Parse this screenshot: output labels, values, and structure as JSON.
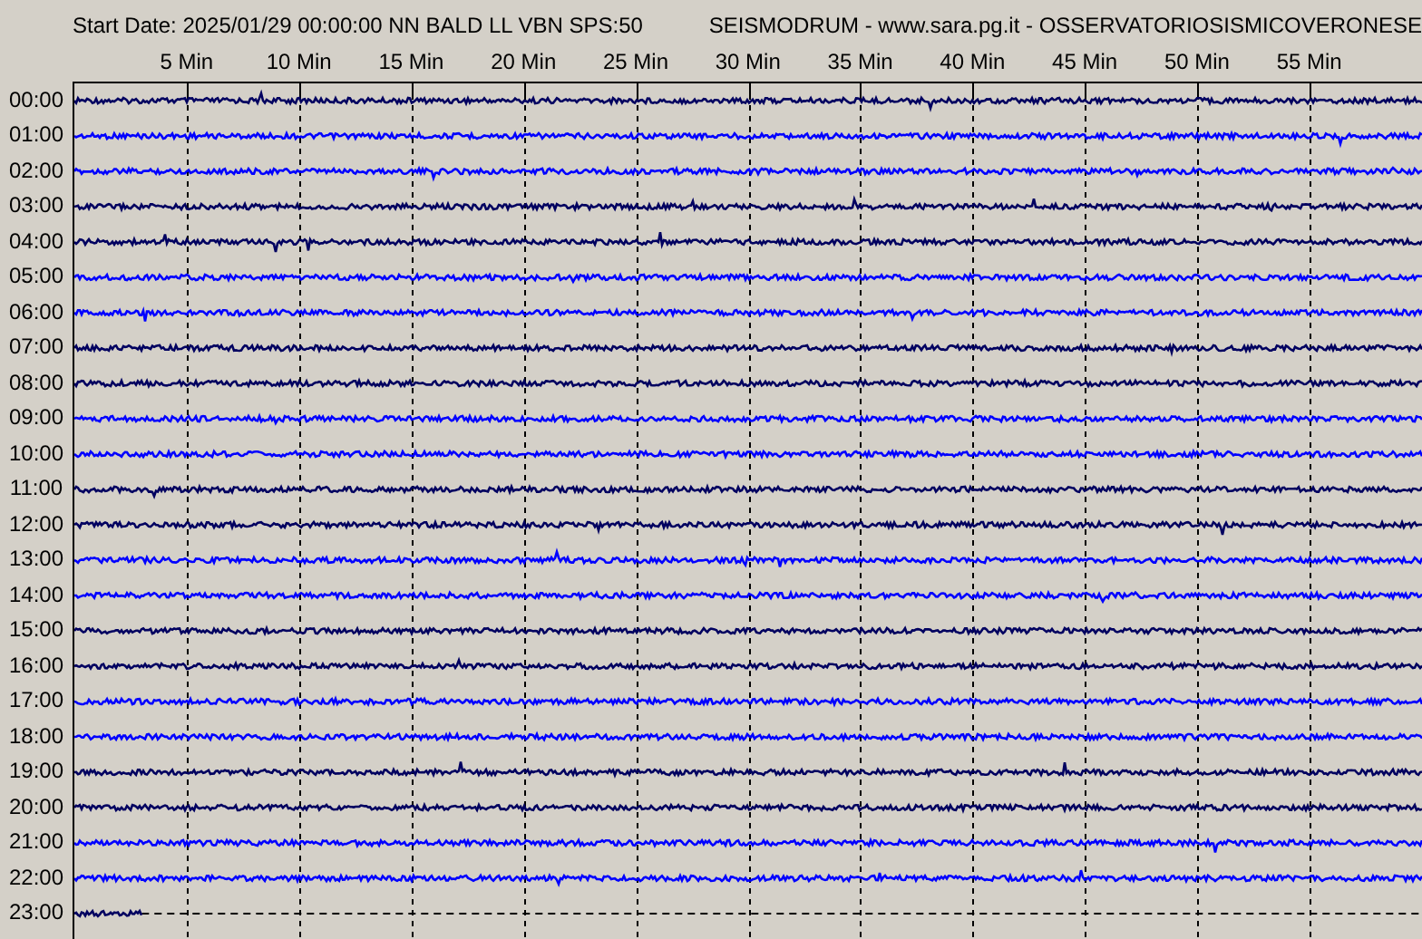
{
  "header": {
    "start_date": "Start Date: 2025/01/29 00:00:00 NN BALD LL VBN SPS:50",
    "title": "SEISMODRUM - www.sara.pg.it - OSSERVATORIOSISMICOVERONESE"
  },
  "minute_labels": [
    "5 Min",
    "10 Min",
    "15 Min",
    "20 Min",
    "25 Min",
    "30 Min",
    "35 Min",
    "40 Min",
    "45 Min",
    "50 Min",
    "55 Min"
  ],
  "rows": [
    {
      "time": "00:00",
      "color": "#000060",
      "level": 1
    },
    {
      "time": "01:00",
      "color": "#0000ff",
      "level": 1
    },
    {
      "time": "02:00",
      "color": "#0000ff",
      "level": 1
    },
    {
      "time": "03:00",
      "color": "#000060",
      "level": 1
    },
    {
      "time": "04:00",
      "color": "#000060",
      "level": 1
    },
    {
      "time": "05:00",
      "color": "#0000ff",
      "level": 1
    },
    {
      "time": "06:00",
      "color": "#0000ff",
      "level": 1
    },
    {
      "time": "07:00",
      "color": "#000060",
      "level": 1
    },
    {
      "time": "08:00",
      "color": "#000060",
      "level": 1
    },
    {
      "time": "09:00",
      "color": "#0000ff",
      "level": 1
    },
    {
      "time": "10:00",
      "color": "#0000ff",
      "level": 1
    },
    {
      "time": "11:00",
      "color": "#000060",
      "level": 1
    },
    {
      "time": "12:00",
      "color": "#000060",
      "level": 1
    },
    {
      "time": "13:00",
      "color": "#0000ff",
      "level": 1
    },
    {
      "time": "14:00",
      "color": "#0000ff",
      "level": 1
    },
    {
      "time": "15:00",
      "color": "#000060",
      "level": 1
    },
    {
      "time": "16:00",
      "color": "#000060",
      "level": 1
    },
    {
      "time": "17:00",
      "color": "#0000ff",
      "level": 1
    },
    {
      "time": "18:00",
      "color": "#0000ff",
      "level": 1
    },
    {
      "time": "19:00",
      "color": "#000060",
      "level": 1
    },
    {
      "time": "20:00",
      "color": "#000060",
      "level": 1
    },
    {
      "time": "21:00",
      "color": "#0000ff",
      "level": 1
    },
    {
      "time": "22:00",
      "color": "#0000ff",
      "level": 1
    },
    {
      "time": "23:00",
      "color": "#000060",
      "level": 0.05
    }
  ]
}
